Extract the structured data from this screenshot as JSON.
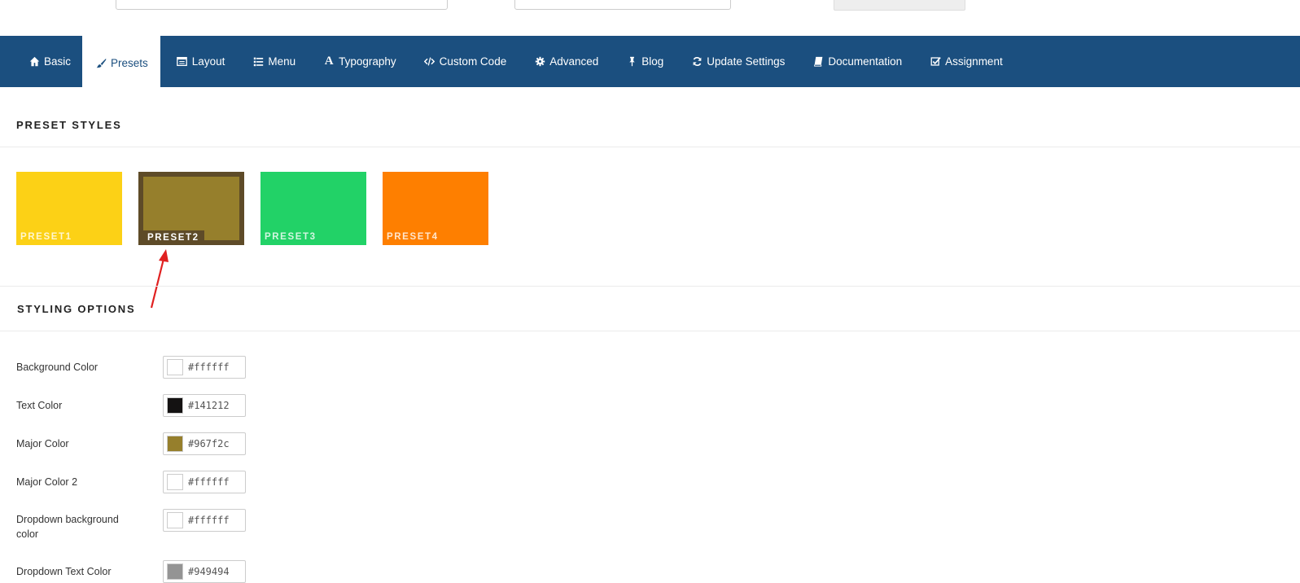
{
  "nav": {
    "tabs": [
      {
        "label": "Basic",
        "icon": "home-icon"
      },
      {
        "label": "Presets",
        "icon": "paintbrush-icon",
        "active": true
      },
      {
        "label": "Layout",
        "icon": "layout-icon"
      },
      {
        "label": "Menu",
        "icon": "list-icon"
      },
      {
        "label": "Typography",
        "icon": "font-icon"
      },
      {
        "label": "Custom Code",
        "icon": "code-icon"
      },
      {
        "label": "Advanced",
        "icon": "gear-icon"
      },
      {
        "label": "Blog",
        "icon": "pin-icon"
      },
      {
        "label": "Update Settings",
        "icon": "refresh-icon"
      },
      {
        "label": "Documentation",
        "icon": "book-icon"
      },
      {
        "label": "Assignment",
        "icon": "check-square-icon"
      }
    ]
  },
  "preset_styles": {
    "title": "PRESET STYLES",
    "presets": [
      {
        "label": "PRESET1",
        "color": "#fcd116"
      },
      {
        "label": "PRESET2",
        "color": "#967f2c",
        "selected": true
      },
      {
        "label": "PRESET3",
        "color": "#22d267"
      },
      {
        "label": "PRESET4",
        "color": "#fe7f00"
      }
    ]
  },
  "styling_options": {
    "title": "STYLING OPTIONS",
    "options": [
      {
        "label": "Background Color",
        "value": "#ffffff"
      },
      {
        "label": "Text Color",
        "value": "#141212"
      },
      {
        "label": "Major Color",
        "value": "#967f2c"
      },
      {
        "label": "Major Color 2",
        "value": "#ffffff"
      },
      {
        "label": "Dropdown background color",
        "value": "#ffffff"
      },
      {
        "label": "Dropdown Text Color",
        "value": "#949494"
      }
    ]
  },
  "colors": {
    "navbar": "#1b4f7f",
    "annotation_arrow": "#e02020"
  }
}
